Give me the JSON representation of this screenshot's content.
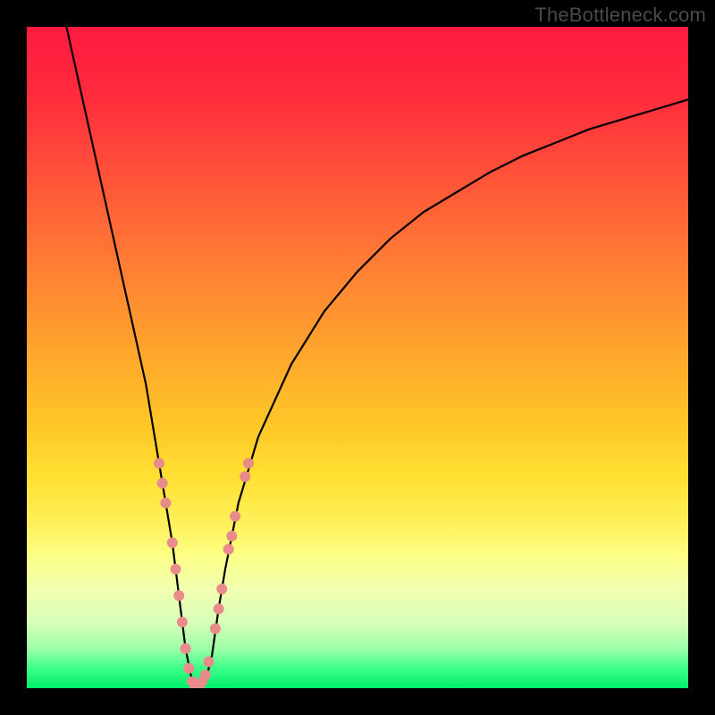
{
  "watermark": "TheBottleneck.com",
  "chart_data": {
    "type": "line",
    "title": "",
    "xlabel": "",
    "ylabel": "",
    "xlim": [
      0,
      100
    ],
    "ylim": [
      0,
      100
    ],
    "grid": false,
    "legend": false,
    "background": {
      "type": "vertical-gradient",
      "stops": [
        {
          "pos": 0.0,
          "color": "#ff1a40"
        },
        {
          "pos": 0.5,
          "color": "#ffa82c"
        },
        {
          "pos": 0.75,
          "color": "#fff05a"
        },
        {
          "pos": 0.94,
          "color": "#9effa8"
        },
        {
          "pos": 1.0,
          "color": "#00ee6a"
        }
      ]
    },
    "series": [
      {
        "name": "bottleneck-curve",
        "color": "#000000",
        "x": [
          6,
          8,
          10,
          12,
          14,
          16,
          18,
          20,
          21,
          22,
          23,
          24,
          25,
          26,
          27,
          28,
          29,
          30,
          32,
          35,
          40,
          45,
          50,
          55,
          60,
          65,
          70,
          75,
          80,
          85,
          90,
          95,
          100
        ],
        "y": [
          100,
          91,
          82,
          73,
          64,
          55,
          46,
          34,
          28,
          22,
          14,
          6,
          1,
          0,
          1,
          5,
          12,
          18,
          28,
          38,
          49,
          57,
          63,
          68,
          72,
          75,
          78,
          80.5,
          82.5,
          84.5,
          86,
          87.5,
          89
        ]
      }
    ],
    "markers": {
      "name": "highlight-dots",
      "color": "#e98b8b",
      "radius_px": 6,
      "points": [
        {
          "x": 20.0,
          "y": 34
        },
        {
          "x": 20.5,
          "y": 31
        },
        {
          "x": 21.0,
          "y": 28
        },
        {
          "x": 22.0,
          "y": 22
        },
        {
          "x": 22.5,
          "y": 18
        },
        {
          "x": 23.0,
          "y": 14
        },
        {
          "x": 23.5,
          "y": 10
        },
        {
          "x": 24.0,
          "y": 6
        },
        {
          "x": 24.5,
          "y": 3
        },
        {
          "x": 25.0,
          "y": 1
        },
        {
          "x": 25.5,
          "y": 0
        },
        {
          "x": 26.0,
          "y": 0
        },
        {
          "x": 26.5,
          "y": 1
        },
        {
          "x": 27.0,
          "y": 2
        },
        {
          "x": 27.5,
          "y": 4
        },
        {
          "x": 28.5,
          "y": 9
        },
        {
          "x": 29.0,
          "y": 12
        },
        {
          "x": 29.5,
          "y": 15
        },
        {
          "x": 30.5,
          "y": 21
        },
        {
          "x": 31.0,
          "y": 23
        },
        {
          "x": 31.5,
          "y": 26
        },
        {
          "x": 33.0,
          "y": 32
        },
        {
          "x": 33.5,
          "y": 34
        }
      ]
    }
  }
}
